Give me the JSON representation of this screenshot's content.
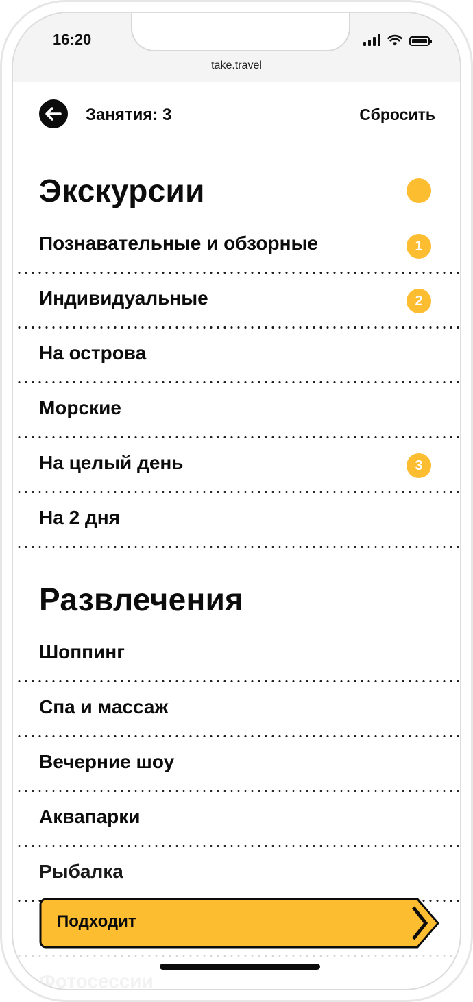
{
  "status_bar": {
    "time": "16:20",
    "url": "take.travel"
  },
  "header": {
    "title": "Занятия: 3",
    "reset_label": "Сбросить"
  },
  "sections": [
    {
      "title": "Экскурсии",
      "has_indicator": true,
      "items": [
        {
          "label": "Познавательные и обзорные",
          "badge": "1"
        },
        {
          "label": "Индивидуальные",
          "badge": "2"
        },
        {
          "label": "На острова",
          "badge": ""
        },
        {
          "label": "Морские",
          "badge": ""
        },
        {
          "label": "На целый день",
          "badge": "3"
        },
        {
          "label": "На 2 дня",
          "badge": ""
        }
      ]
    },
    {
      "title": "Развлечения",
      "has_indicator": false,
      "items": [
        {
          "label": "Шоппинг",
          "badge": ""
        },
        {
          "label": "Спа и массаж",
          "badge": ""
        },
        {
          "label": "Вечерние шоу",
          "badge": ""
        },
        {
          "label": "Аквапарки",
          "badge": ""
        },
        {
          "label": "Рыбалка",
          "badge": ""
        },
        {
          "label": "Фотосессии",
          "badge": ""
        }
      ]
    }
  ],
  "cta": {
    "label": "Подходит"
  },
  "colors": {
    "accent": "#fdbd31",
    "text": "#0c0c0c",
    "background": "#ffffff"
  },
  "icons": {
    "back": "arrow-left-icon",
    "cta": "chevron-right-icon"
  }
}
